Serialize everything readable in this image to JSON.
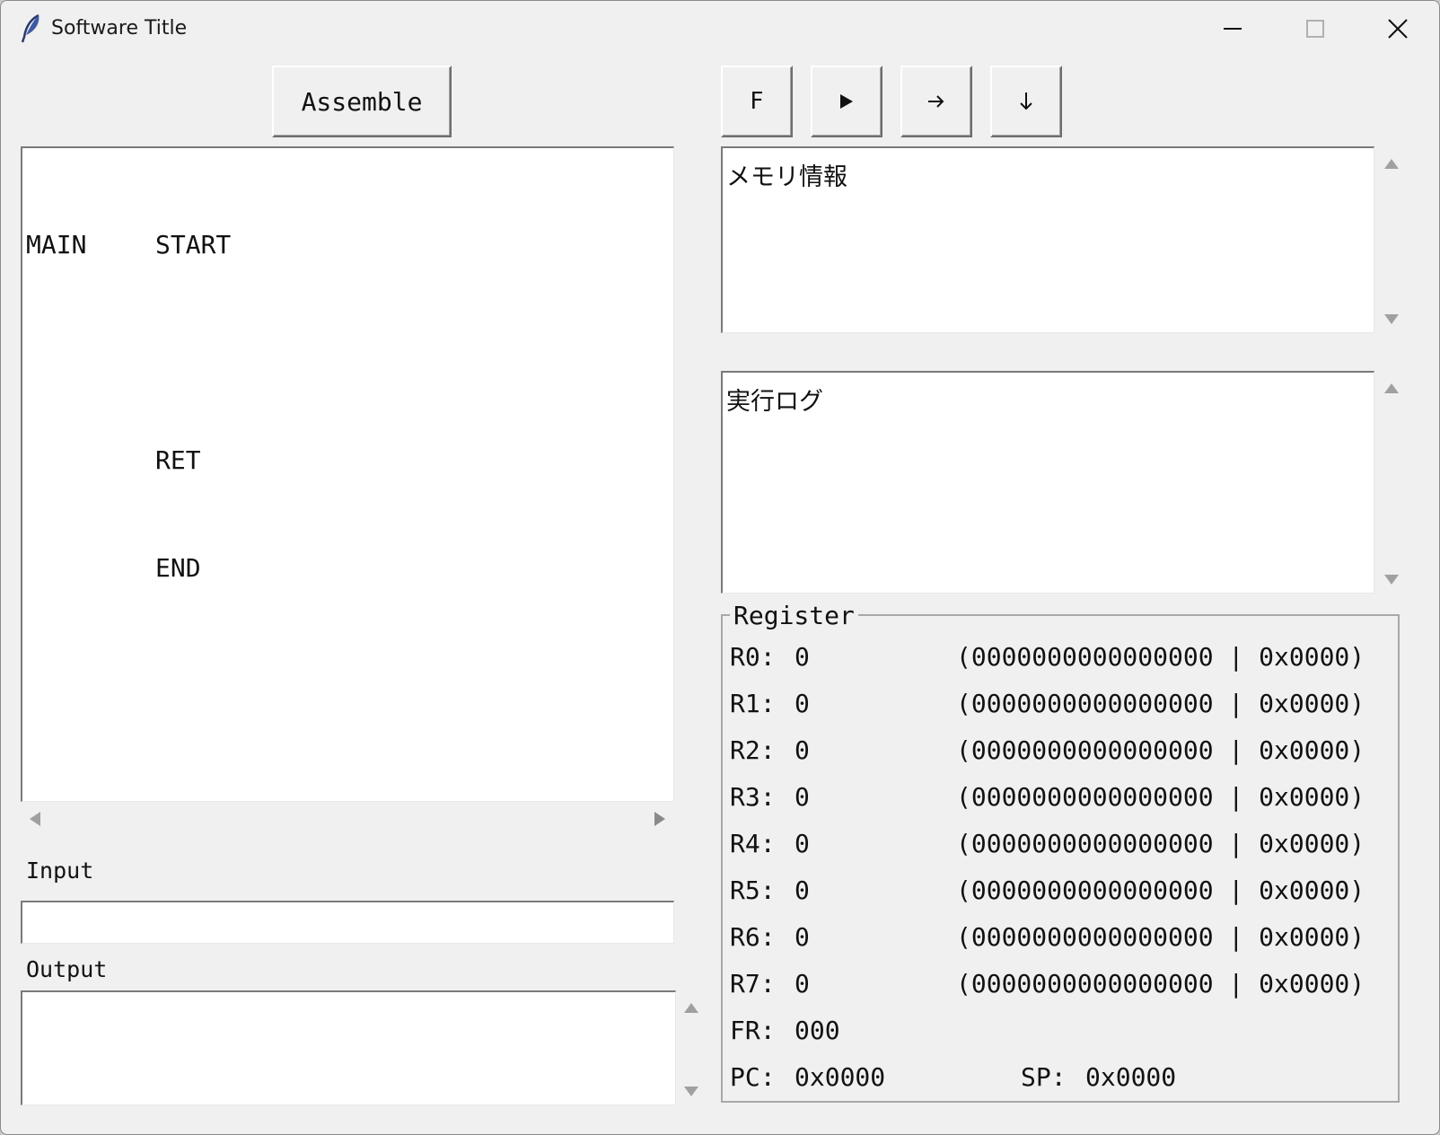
{
  "window": {
    "title": "Software Title"
  },
  "toolbar": {
    "assemble_label": "Assemble",
    "buttons": [
      {
        "label": "F"
      },
      {
        "icon": "play-icon"
      },
      {
        "icon": "arrow-right-icon"
      },
      {
        "icon": "arrow-down-icon"
      }
    ]
  },
  "editor": {
    "lines": [
      {
        "label": "MAIN",
        "op": "START"
      },
      {
        "label": "",
        "op": ""
      },
      {
        "label": "",
        "op": "RET"
      },
      {
        "label": "",
        "op": "END"
      }
    ]
  },
  "memory": {
    "text": "メモリ情報"
  },
  "log": {
    "text": "実行ログ"
  },
  "io": {
    "input_label": "Input",
    "input_value": "",
    "output_label": "Output",
    "output_value": ""
  },
  "register": {
    "title": "Register",
    "rows": [
      {
        "name": "R0:",
        "value": "0",
        "detail": "(0000000000000000 | 0x0000)"
      },
      {
        "name": "R1:",
        "value": "0",
        "detail": "(0000000000000000 | 0x0000)"
      },
      {
        "name": "R2:",
        "value": "0",
        "detail": "(0000000000000000 | 0x0000)"
      },
      {
        "name": "R3:",
        "value": "0",
        "detail": "(0000000000000000 | 0x0000)"
      },
      {
        "name": "R4:",
        "value": "0",
        "detail": "(0000000000000000 | 0x0000)"
      },
      {
        "name": "R5:",
        "value": "0",
        "detail": "(0000000000000000 | 0x0000)"
      },
      {
        "name": "R6:",
        "value": "0",
        "detail": "(0000000000000000 | 0x0000)"
      },
      {
        "name": "R7:",
        "value": "0",
        "detail": "(0000000000000000 | 0x0000)"
      }
    ],
    "fr": {
      "name": "FR:",
      "value": "000"
    },
    "pc": {
      "name": "PC:",
      "value": "0x0000"
    },
    "sp": {
      "name": "SP:",
      "value": "0x0000"
    }
  },
  "colors": {
    "window_bg": "#f0f0f0",
    "text_bg": "#ffffff",
    "text": "#111111",
    "border": "#7a7a7a"
  }
}
